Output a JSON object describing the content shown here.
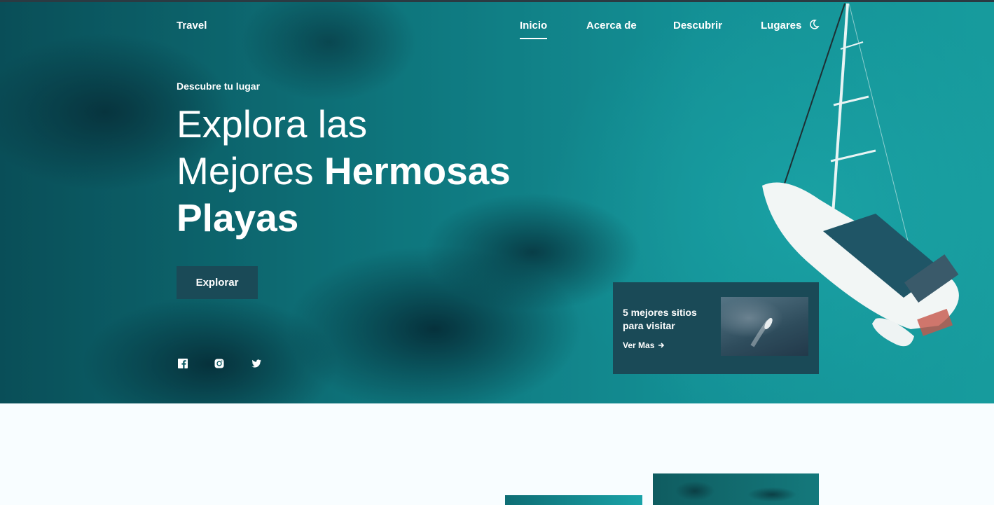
{
  "nav": {
    "logo": "Travel",
    "links": [
      {
        "label": "Inicio",
        "active": true
      },
      {
        "label": "Acerca de",
        "active": false
      },
      {
        "label": "Descubrir",
        "active": false
      },
      {
        "label": "Lugares",
        "active": false
      }
    ],
    "theme_icon": "moon-icon"
  },
  "hero": {
    "subtitle": "Descubre tu lugar",
    "title_line1": "Explora las",
    "title_line2_regular": "Mejores ",
    "title_line2_bold": "Hermosas",
    "title_line3_bold": "Playas",
    "button_label": "Explorar"
  },
  "social": [
    "facebook-icon",
    "instagram-icon",
    "twitter-icon"
  ],
  "card": {
    "title": "5 mejores sitios para visitar",
    "link_label": "Ver Mas",
    "link_icon": "arrow-right-icon"
  },
  "colors": {
    "accent": "#1a4a57",
    "text": "#ffffff",
    "background": "#f8fdff"
  }
}
